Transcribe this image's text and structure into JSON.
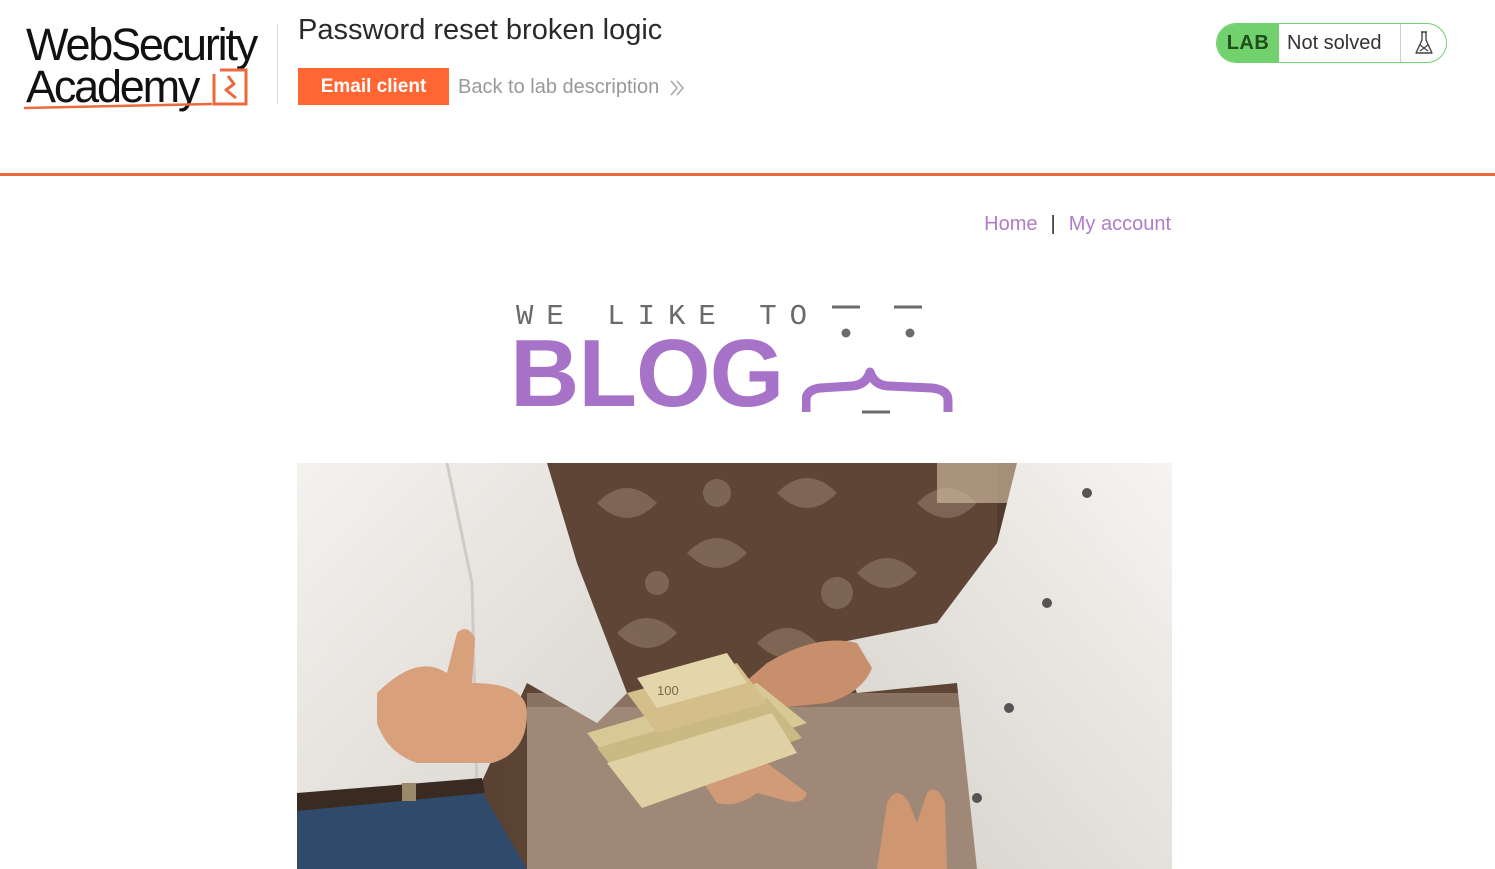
{
  "academy": {
    "logo_line1": "WebSecurity",
    "logo_line2": "Academy",
    "lab_title": "Password reset broken logic",
    "email_client_label": "Email client",
    "back_link_label": "Back to lab description",
    "lab_badge": "LAB",
    "lab_status": "Not solved",
    "accent_color": "#ff6633",
    "status_color": "#70d16d"
  },
  "nav": {
    "home_label": "Home",
    "separator": "|",
    "account_label": "My account",
    "link_color": "#b07cc6"
  },
  "banner": {
    "tagline": "WE LIKE TO",
    "title": "BLOG",
    "title_color": "#a773c8"
  },
  "hero": {
    "alt": "",
    "icon": "money-handover-photo"
  }
}
